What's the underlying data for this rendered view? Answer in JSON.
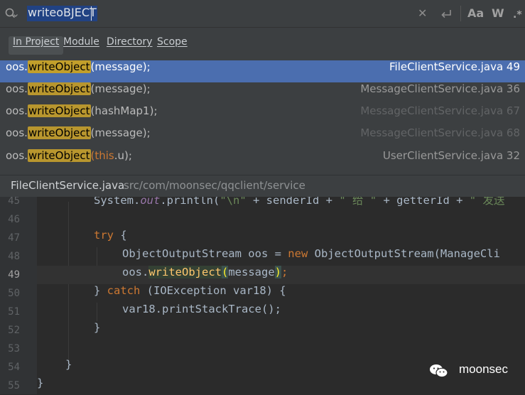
{
  "search": {
    "query": "writeoBJECT",
    "case_toggle": "Aa",
    "word_toggle": "W"
  },
  "scopes": [
    "In Project",
    "Module",
    "Directory",
    "Scope"
  ],
  "results": [
    {
      "prefix": "oos.",
      "match": "writeObject",
      "suffix": "(message);",
      "file": "FileClientService.java 49"
    },
    {
      "prefix": "oos.",
      "match": "writeObject",
      "suffix": "(message);",
      "file": "MessageClientService.java 36"
    },
    {
      "prefix": "oos.",
      "match": "writeObject",
      "suffix": "(hashMap1);",
      "file": "MessageClientService.java 67"
    },
    {
      "prefix": "oos.",
      "match": "writeObject",
      "suffix": "(message);",
      "file": "MessageClientService.java 68"
    },
    {
      "prefix": "oos.",
      "match": "writeObject",
      "suffix_kw": "(this",
      "suffix": ".u);",
      "file": "UserClientService.java 32"
    }
  ],
  "status": {
    "file": "FileClientService.java",
    "path": "src/com/moonsec/qqclient/service"
  },
  "editor": {
    "line_numbers": [
      "45",
      "46",
      "47",
      "48",
      "49",
      "50",
      "51",
      "52",
      "53",
      "54",
      "55"
    ],
    "l45": {
      "a": "System.",
      "b": "out",
      "c": ".println(",
      "d": "\"\\n\"",
      "e": " + senderId + ",
      "f": "\" 给 \"",
      "g": " + getterId + ",
      "h": "\" 发送"
    },
    "l47": {
      "kw": "try",
      "rest": " {"
    },
    "l48": {
      "a": "ObjectOutputStream oos = ",
      "kw": "new",
      "b": " ObjectOutputStream(ManageCli"
    },
    "l49": {
      "a": "oos.",
      "fn": "writeObject",
      "p1": "(",
      "b": "message",
      "p2": ")",
      "c": ";"
    },
    "l50": {
      "a": "} ",
      "kw": "catch",
      "b": " (IOException var18) {"
    },
    "l51": {
      "a": "var18.printStackTrace();"
    },
    "l52": {
      "a": "}"
    },
    "l54": {
      "a": "}"
    },
    "l55": {
      "a": "}"
    }
  },
  "watermark": "moonsec"
}
